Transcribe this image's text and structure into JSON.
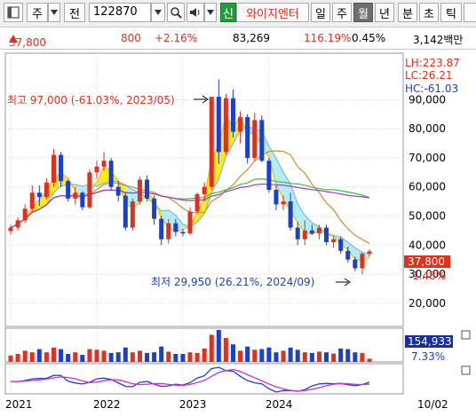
{
  "toolbar": {
    "market_label": "주",
    "jeon_label": "전",
    "code_value": "122870",
    "credit_label": "신",
    "company_name": "와이지엔터",
    "period_day": "일",
    "period_week": "주",
    "period_month": "월",
    "period_year": "년",
    "period_minute": "분",
    "period_second": "초",
    "period_tick": "틱",
    "active_period": "월"
  },
  "quote": {
    "price": "37,800",
    "change": "800",
    "change_pct": "+2.16%",
    "volume": "83,269",
    "volume_ratio": "116.19%",
    "turnover": "0.45%",
    "amount": "3,142백만",
    "up_color": "#e0301e",
    "down_color": "#1a3fd1"
  },
  "chart_data": {
    "type": "candlestick",
    "x_labels": [
      "2021",
      "2022",
      "2023",
      "2024",
      "10/02"
    ],
    "y_ticks": [
      "90,000",
      "80,000",
      "70,000",
      "60,000",
      "50,000",
      "40,000",
      "30,000",
      "20,000"
    ],
    "ylim": [
      12000,
      106000
    ],
    "info": {
      "lh": "LH:223.87",
      "lc": "LC:26.21",
      "hc": "HC:-61.03"
    },
    "annotations": {
      "high": "최고 97,000 (-61.03%, 2023/05)",
      "low": "최저 29,950 (26.21%, 2024/09)"
    },
    "current_price_label": "37,800",
    "current_pct_label": "1.48%",
    "volume_label": "154,933",
    "volume_pct_label": "7.33%",
    "candles": [
      {
        "o": 44800,
        "h": 47000,
        "l": 43600,
        "c": 46000
      },
      {
        "o": 46000,
        "h": 49500,
        "l": 45000,
        "c": 48500
      },
      {
        "o": 48500,
        "h": 54000,
        "l": 47600,
        "c": 52500
      },
      {
        "o": 52500,
        "h": 60500,
        "l": 51500,
        "c": 58000
      },
      {
        "o": 58000,
        "h": 60500,
        "l": 53500,
        "c": 56500
      },
      {
        "o": 56500,
        "h": 63000,
        "l": 55500,
        "c": 61500
      },
      {
        "o": 61500,
        "h": 73000,
        "l": 60000,
        "c": 71000
      },
      {
        "o": 71000,
        "h": 72000,
        "l": 60000,
        "c": 62000
      },
      {
        "o": 62000,
        "h": 62500,
        "l": 55000,
        "c": 56000
      },
      {
        "o": 56000,
        "h": 60000,
        "l": 54000,
        "c": 58000
      },
      {
        "o": 58000,
        "h": 58500,
        "l": 52000,
        "c": 53000
      },
      {
        "o": 53000,
        "h": 66000,
        "l": 52500,
        "c": 65000
      },
      {
        "o": 65000,
        "h": 69000,
        "l": 63000,
        "c": 67000
      },
      {
        "o": 67000,
        "h": 72000,
        "l": 65500,
        "c": 69000
      },
      {
        "o": 69000,
        "h": 70000,
        "l": 59000,
        "c": 60000
      },
      {
        "o": 60000,
        "h": 62000,
        "l": 55000,
        "c": 57000
      },
      {
        "o": 57000,
        "h": 58000,
        "l": 45000,
        "c": 46000
      },
      {
        "o": 46000,
        "h": 56000,
        "l": 45000,
        "c": 55000
      },
      {
        "o": 55000,
        "h": 63500,
        "l": 54000,
        "c": 62500
      },
      {
        "o": 62500,
        "h": 64000,
        "l": 55000,
        "c": 56000
      },
      {
        "o": 56000,
        "h": 57000,
        "l": 47000,
        "c": 49000
      },
      {
        "o": 49000,
        "h": 50000,
        "l": 40000,
        "c": 42000
      },
      {
        "o": 42000,
        "h": 49000,
        "l": 40500,
        "c": 47500
      },
      {
        "o": 47500,
        "h": 49000,
        "l": 43000,
        "c": 44500
      },
      {
        "o": 44500,
        "h": 45500,
        "l": 43000,
        "c": 44000
      },
      {
        "o": 44000,
        "h": 53000,
        "l": 43500,
        "c": 51500
      },
      {
        "o": 51500,
        "h": 58000,
        "l": 51000,
        "c": 57500
      },
      {
        "o": 57500,
        "h": 61500,
        "l": 55000,
        "c": 60000
      },
      {
        "o": 60000,
        "h": 80000,
        "l": 59000,
        "c": 91000
      },
      {
        "o": 91000,
        "h": 97000,
        "l": 68000,
        "c": 72000
      },
      {
        "o": 72000,
        "h": 92000,
        "l": 71000,
        "c": 90500
      },
      {
        "o": 90500,
        "h": 93500,
        "l": 77000,
        "c": 79000
      },
      {
        "o": 79000,
        "h": 86000,
        "l": 75000,
        "c": 84000
      },
      {
        "o": 84000,
        "h": 85000,
        "l": 68000,
        "c": 70000
      },
      {
        "o": 70000,
        "h": 85500,
        "l": 69000,
        "c": 83000
      },
      {
        "o": 83000,
        "h": 84500,
        "l": 68500,
        "c": 69000
      },
      {
        "o": 69000,
        "h": 70000,
        "l": 58000,
        "c": 59000
      },
      {
        "o": 59000,
        "h": 60500,
        "l": 52000,
        "c": 54000
      },
      {
        "o": 54000,
        "h": 57000,
        "l": 52000,
        "c": 55000
      },
      {
        "o": 55000,
        "h": 58000,
        "l": 45000,
        "c": 46000
      },
      {
        "o": 46000,
        "h": 48000,
        "l": 40000,
        "c": 42000
      },
      {
        "o": 42000,
        "h": 48500,
        "l": 40000,
        "c": 45000
      },
      {
        "o": 45000,
        "h": 47000,
        "l": 43500,
        "c": 44000
      },
      {
        "o": 44000,
        "h": 47000,
        "l": 42000,
        "c": 46000
      },
      {
        "o": 46000,
        "h": 47000,
        "l": 40000,
        "c": 41000
      },
      {
        "o": 41000,
        "h": 43000,
        "l": 39000,
        "c": 42000
      },
      {
        "o": 42000,
        "h": 43000,
        "l": 37000,
        "c": 38000
      },
      {
        "o": 38000,
        "h": 39500,
        "l": 34000,
        "c": 35000
      },
      {
        "o": 35000,
        "h": 36000,
        "l": 31000,
        "c": 32000
      },
      {
        "o": 32000,
        "h": 37500,
        "l": 29950,
        "c": 37000
      },
      {
        "o": 37000,
        "h": 38500,
        "l": 36000,
        "c": 37800
      }
    ],
    "volumes": [
      0.2,
      0.25,
      0.35,
      0.3,
      0.4,
      0.3,
      0.45,
      0.4,
      0.25,
      0.3,
      0.22,
      0.4,
      0.38,
      0.35,
      0.28,
      0.3,
      0.45,
      0.3,
      0.35,
      0.28,
      0.3,
      0.48,
      0.32,
      0.25,
      0.25,
      0.3,
      0.28,
      0.42,
      0.85,
      1.0,
      0.75,
      0.55,
      0.35,
      0.48,
      0.38,
      0.4,
      0.45,
      0.3,
      0.35,
      0.45,
      0.38,
      0.3,
      0.28,
      0.32,
      0.3,
      0.26,
      0.42,
      0.4,
      0.3,
      0.28,
      0.1
    ]
  }
}
